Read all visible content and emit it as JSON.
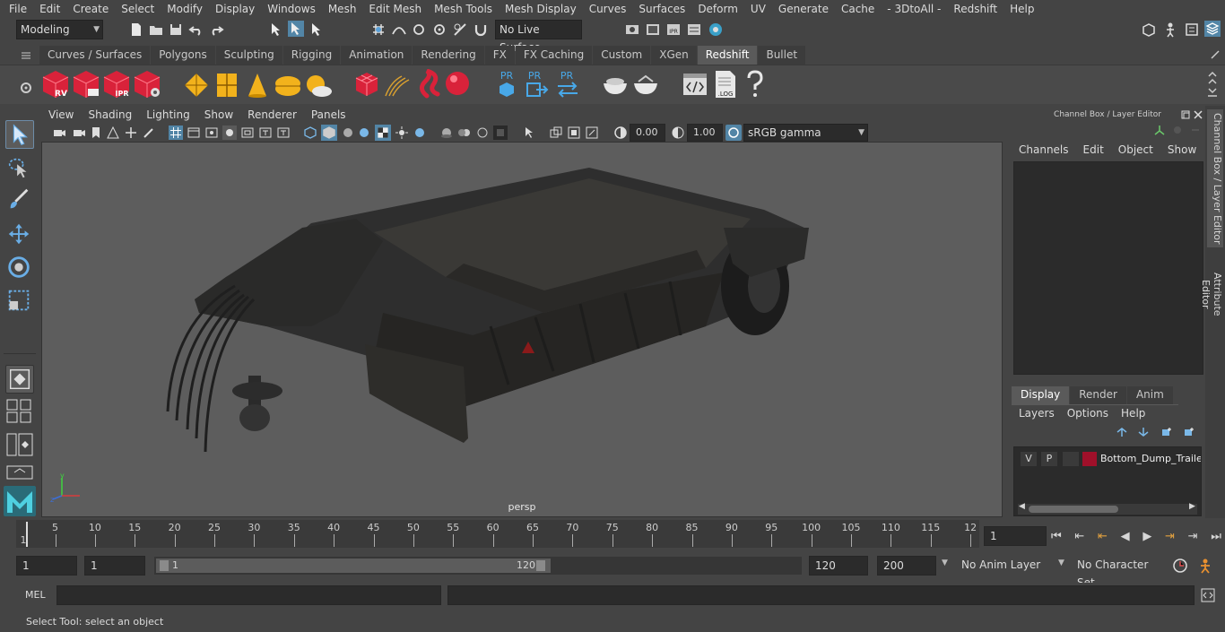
{
  "menubar": {
    "items": [
      "File",
      "Edit",
      "Create",
      "Select",
      "Modify",
      "Display",
      "Windows",
      "Mesh",
      "Edit Mesh",
      "Mesh Tools",
      "Mesh Display",
      "Curves",
      "Surfaces",
      "Deform",
      "UV",
      "Generate",
      "Cache",
      "- 3DtoAll -",
      "Redshift",
      "Help"
    ]
  },
  "statusline": {
    "mode": "Modeling",
    "live_surface": "No Live Surface"
  },
  "shelf": {
    "tabs": [
      "Curves / Surfaces",
      "Polygons",
      "Sculpting",
      "Rigging",
      "Animation",
      "Rendering",
      "FX",
      "FX Caching",
      "Custom",
      "XGen",
      "Redshift",
      "Bullet"
    ],
    "active_tab": "Redshift",
    "icon_labels": {
      "rv": "RV",
      "ipr": "IPR",
      "pr1": "PR",
      "pr2": "PR",
      "pr3": "PR",
      "log": ".LOG"
    }
  },
  "viewport": {
    "menu": [
      "View",
      "Shading",
      "Lighting",
      "Show",
      "Renderer",
      "Panels"
    ],
    "exposure": "0.00",
    "gamma": "1.00",
    "color_space": "sRGB gamma",
    "camera_label": "persp",
    "axis": {
      "y": "y",
      "z": "z"
    }
  },
  "channelbox": {
    "title": "Channel Box / Layer Editor",
    "menu": [
      "Channels",
      "Edit",
      "Object",
      "Show"
    ],
    "layer_tabs": [
      "Display",
      "Render",
      "Anim"
    ],
    "active_layer_tab": "Display",
    "layer_menu": [
      "Layers",
      "Options",
      "Help"
    ],
    "layer": {
      "v": "V",
      "p": "P",
      "name": "Bottom_Dump_Trailer_",
      "color": "#a0102a"
    }
  },
  "side_tabs": [
    "Channel Box / Layer Editor",
    "Attribute Editor"
  ],
  "timeline": {
    "ticks": [
      "5",
      "10",
      "15",
      "20",
      "25",
      "30",
      "35",
      "40",
      "45",
      "50",
      "55",
      "60",
      "65",
      "70",
      "75",
      "80",
      "85",
      "90",
      "95",
      "100",
      "105",
      "110",
      "115",
      "12"
    ],
    "start_marker": "1",
    "current_frame": "1"
  },
  "range": {
    "start": "1",
    "anim_start": "1",
    "slider_start": "1",
    "slider_end": "120",
    "end": "120",
    "anim_end": "200",
    "anim_layer": "No Anim Layer",
    "character_set": "No Character Set"
  },
  "mel": {
    "label": "MEL"
  },
  "helpline": {
    "text": "Select Tool: select an object"
  }
}
